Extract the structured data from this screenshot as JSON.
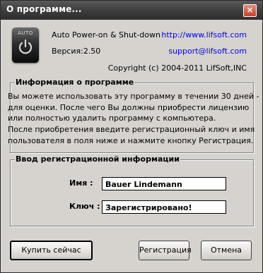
{
  "window": {
    "title": "О программе...",
    "close_glyph": "×"
  },
  "logo": {
    "text": "AUTO",
    "icon": "power-icon"
  },
  "product": {
    "name": "Auto Power-on & Shut-down",
    "version": "Версия:2.50",
    "website": "http://www.lifsoft.com",
    "email": "support@lifsoft.com",
    "copyright": "Copyright (c) 2004-2011 LifSoft,INC"
  },
  "info": {
    "title": "Информация о программе",
    "lines": [
      "Вы можете использовать эту программу в течении 30 дней -",
      "для оценки. После чего Вы должны приобрести лицензию",
      "или полностью удалить программу с компьютера.",
      "После приобретения введите регистрационный ключ и имя",
      "пользователя в поля ниже и нажмите кнопку Регистрация."
    ]
  },
  "registration": {
    "title": "Ввод регистрационной информации",
    "name_label": "Имя   :",
    "name_value": "Bauer Lindemann",
    "key_label": "Ключ :",
    "key_value": "Зарегистрировано!"
  },
  "buttons": {
    "buy": "Купить сейчас",
    "register": "Регистрация",
    "cancel": "Отмена"
  },
  "colors": {
    "titlebar": "#3c3c3c",
    "dialog_bg": "#d6d3ce",
    "link": "#0000ff",
    "close_button": "#c0412c"
  }
}
